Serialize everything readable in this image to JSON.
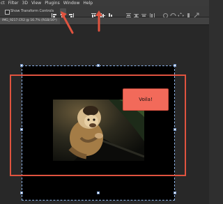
{
  "menu": {
    "items": [
      "ct",
      "Filter",
      "3D",
      "View",
      "Plugins",
      "Window",
      "Help"
    ]
  },
  "options_bar": {
    "show_transform_label": "Show Transform Controls",
    "selected_align": "align-horizontal-centers"
  },
  "document": {
    "tab_title": "IMG_9217.CR2 @ 16.7% (RGB/16*)"
  },
  "canvas": {
    "text_box_label": "Voila!"
  },
  "colors": {
    "annotation_red": "#e0533f",
    "voila_fill": "#f26a5a",
    "selection_blue": "#8fb4e8"
  }
}
